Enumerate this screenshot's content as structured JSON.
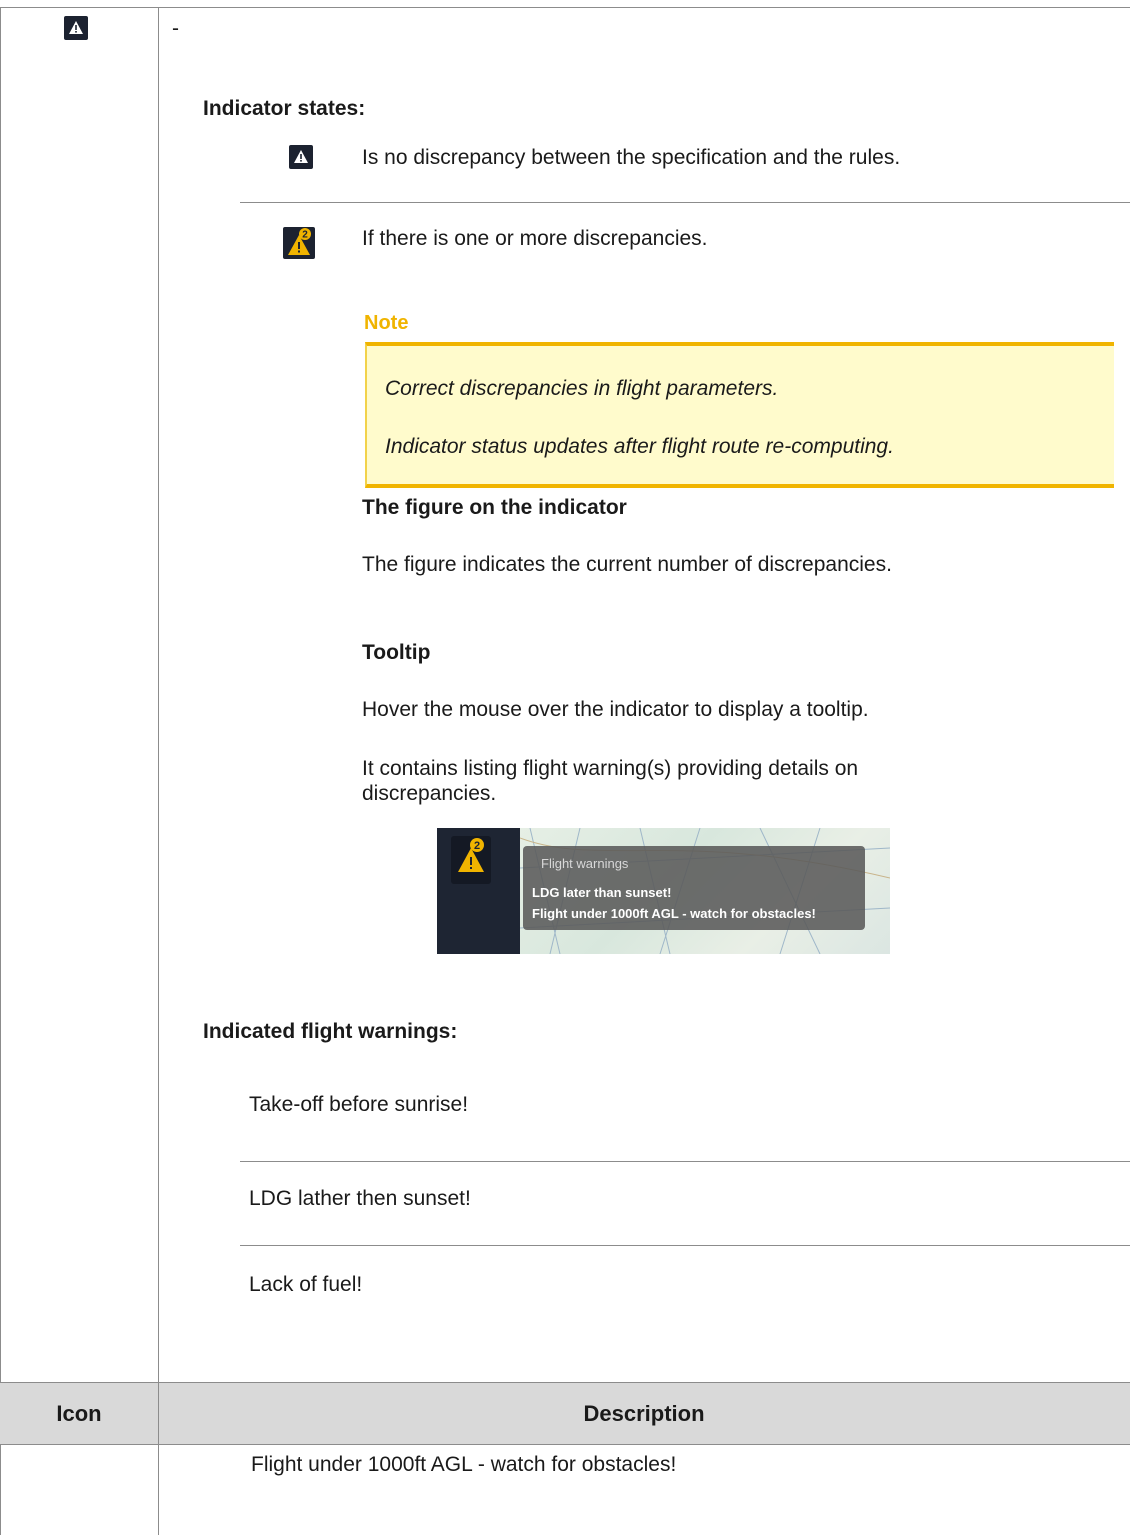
{
  "top_row": {
    "dash": "-"
  },
  "indicator_states": {
    "heading": "Indicator states:",
    "states": [
      {
        "icon": "warning-icon",
        "text": "Is no discrepancy between the specification and the rules."
      },
      {
        "icon": "warning-count-icon",
        "badge": "2",
        "text": "If there is one or more discrepancies."
      }
    ]
  },
  "note": {
    "title": "Note",
    "lines": [
      "Correct discrepancies in flight parameters.",
      "Indicator status updates after flight route re-computing."
    ]
  },
  "figure_section": {
    "heading": "The figure on the indicator",
    "text": "The figure indicates the current number of discrepancies."
  },
  "tooltip_section": {
    "heading": "Tooltip",
    "text1": "Hover the mouse over the indicator to display a tooltip.",
    "text2_line1": "It contains listing flight warning(s) providing details on",
    "text2_line2": "discrepancies."
  },
  "tooltip_example": {
    "badge": "2",
    "title": "Flight warnings",
    "lines": [
      "LDG later than sunset!",
      "Flight under 1000ft AGL - watch for obstacles!"
    ]
  },
  "warnings": {
    "heading": "Indicated flight warnings:",
    "items": [
      "Take-off before sunrise!",
      "LDG lather then sunset!",
      "Lack of fuel!"
    ]
  },
  "table_header": {
    "icon": "Icon",
    "description": "Description"
  },
  "bottom_row": {
    "text": "Flight under 1000ft AGL - watch for obstacles!"
  },
  "colors": {
    "icon_bg": "#1c2230",
    "warning_yellow": "#f0b400",
    "note_bg": "#fffbcc",
    "header_bg": "#d9d9d9"
  }
}
